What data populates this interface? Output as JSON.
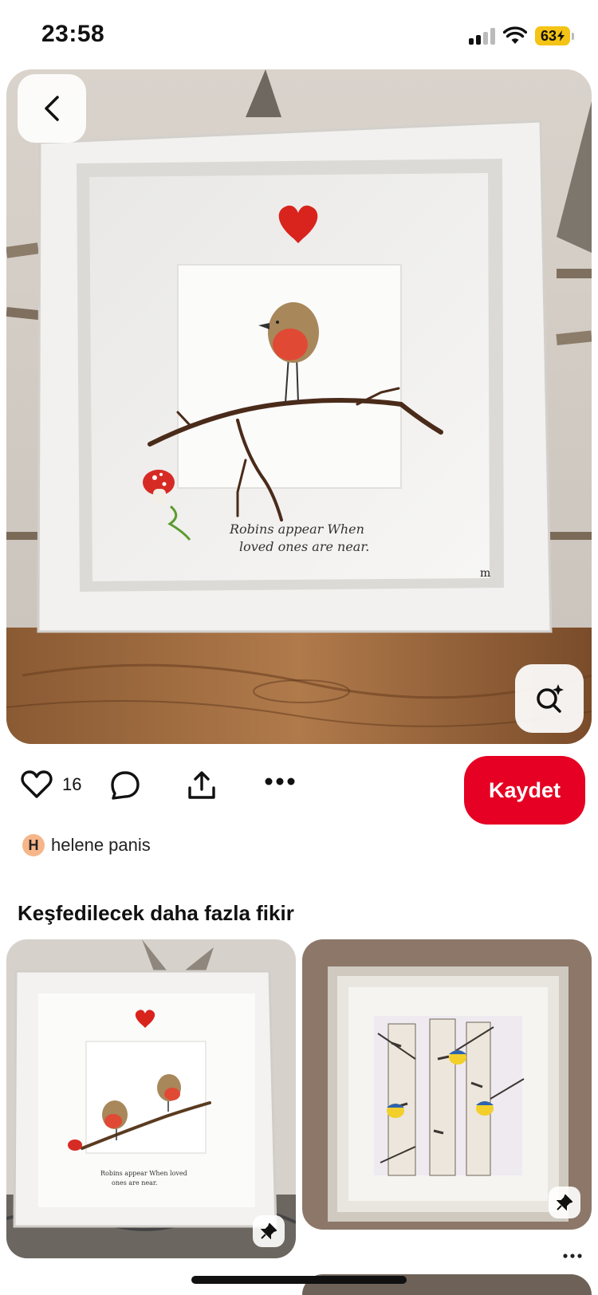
{
  "status_bar": {
    "time": "23:58",
    "battery_level": "63",
    "icons": [
      "signal-icon",
      "wifi-icon",
      "battery-charging-icon"
    ]
  },
  "hero": {
    "image_label": "Framed pebble art robin on branch",
    "caption_line1": "Robins appear When",
    "caption_line2": "loved ones are near.",
    "back_icon": "chevron-left-icon",
    "lens_icon": "visual-search-icon"
  },
  "actions": {
    "like_count": "16",
    "save_label": "Kaydet",
    "icons": [
      "heart-icon",
      "comment-icon",
      "share-icon",
      "more-icon"
    ]
  },
  "creator": {
    "initial": "H",
    "name": "helene panis"
  },
  "more_ideas": {
    "title": "Keşfedilecek daha fazla fikir",
    "pins": [
      {
        "caption_line1": "Robins appear When loved",
        "caption_line2": "ones are near."
      },
      {
        "caption_line1": ""
      }
    ]
  },
  "colors": {
    "save_red": "#e60023",
    "battery_yellow": "#f4c315",
    "avatar_peach": "#f6b68a"
  }
}
